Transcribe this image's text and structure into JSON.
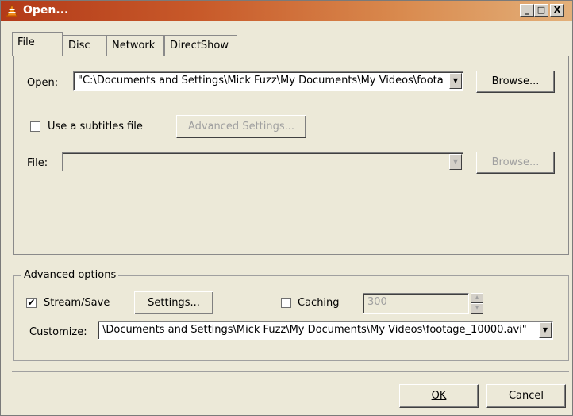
{
  "window": {
    "title": "Open...",
    "minimize": "_",
    "maximize": "□",
    "close": "X"
  },
  "tabs": [
    {
      "label": "File"
    },
    {
      "label": "Disc"
    },
    {
      "label": "Network"
    },
    {
      "label": "DirectShow"
    }
  ],
  "file_tab": {
    "open_label": "Open:",
    "open_value": "\"C:\\Documents and Settings\\Mick Fuzz\\My Documents\\My Videos\\foota",
    "browse_label": "Browse...",
    "subtitles_label": "Use a subtitles file",
    "subtitles_checked": false,
    "advanced_settings_label": "Advanced Settings...",
    "file_label": "File:",
    "file_value": "",
    "file_browse_label": "Browse..."
  },
  "advanced": {
    "group_title": "Advanced options",
    "stream_save_label": "Stream/Save",
    "stream_save_checked": true,
    "settings_label": "Settings...",
    "caching_label": "Caching",
    "caching_checked": false,
    "caching_value": "300",
    "customize_label": "Customize:",
    "customize_value": "\\Documents and Settings\\Mick Fuzz\\My Documents\\My Videos\\footage_10000.avi\""
  },
  "footer": {
    "ok_label": "OK",
    "cancel_label": "Cancel"
  },
  "colors": {
    "titlebar_start": "#b33a19",
    "titlebar_end": "#e3b07a",
    "dialog_bg": "#ece9d8"
  }
}
